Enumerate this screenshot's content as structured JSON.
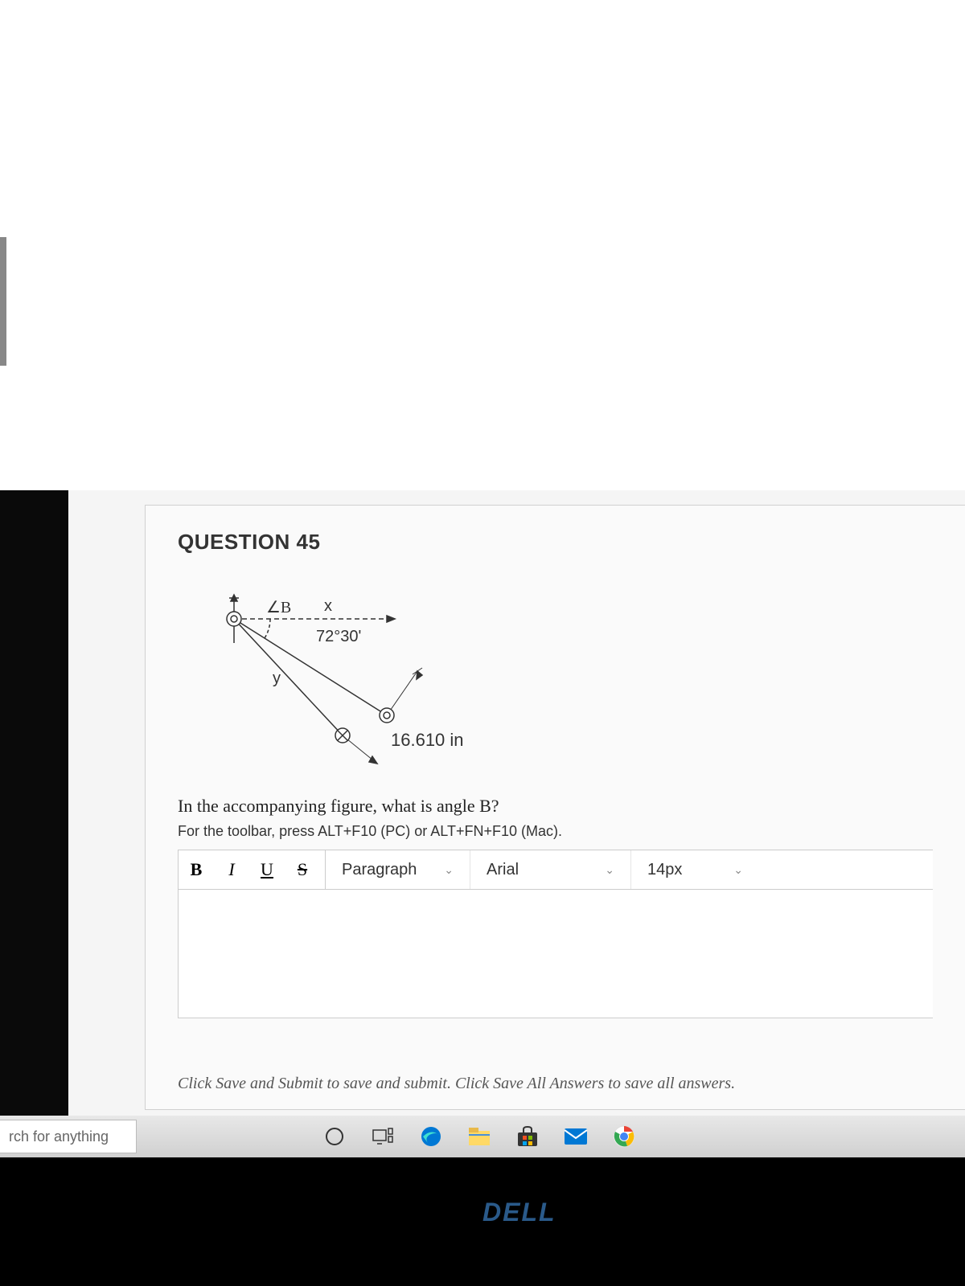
{
  "question": {
    "title": "QUESTION 45",
    "figure": {
      "angle_label": "∠B",
      "x_label": "x",
      "y_label": "y",
      "angle_value": "72°30'",
      "dimension": "16.610 in"
    },
    "prompt": "In the accompanying figure, what is angle B?",
    "toolbar_hint": "For the toolbar, press ALT+F10 (PC) or ALT+FN+F10 (Mac)."
  },
  "editor": {
    "bold": "B",
    "italic": "I",
    "underline": "U",
    "strike": "S",
    "format_select": "Paragraph",
    "font_select": "Arial",
    "size_select": "14px"
  },
  "submit_hint": "Click Save and Submit to save and submit. Click Save All Answers to save all answers.",
  "taskbar": {
    "search_placeholder": "rch for anything"
  },
  "brand": "DELL"
}
